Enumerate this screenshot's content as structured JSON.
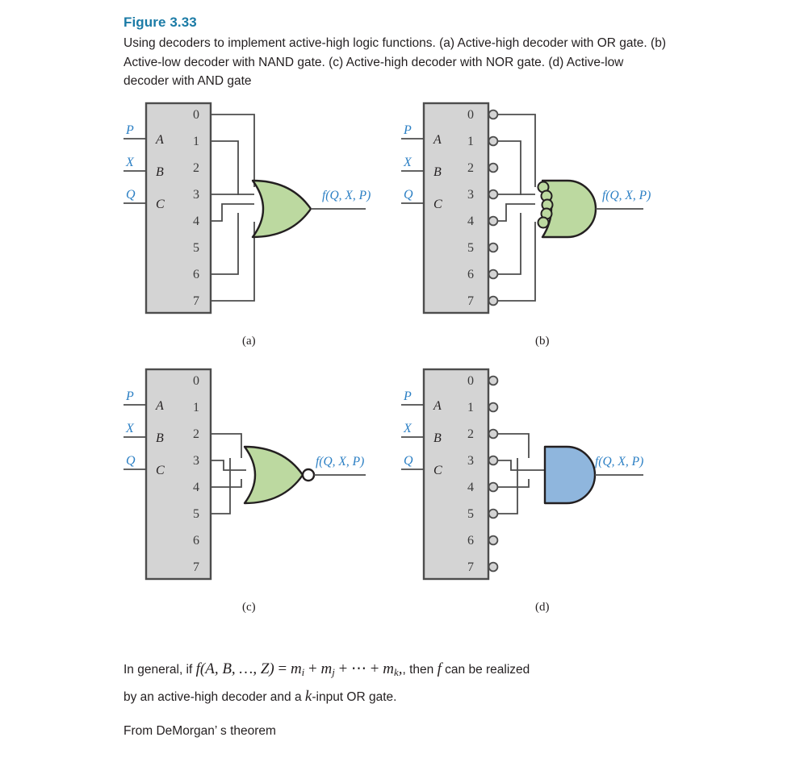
{
  "figure": {
    "title": "Figure 3.33",
    "caption": "Using decoders to implement active-high logic functions. (a) Active-high decoder with OR gate. (b) Active-low decoder with NAND gate. (c) Active-high decoder with NOR gate. (d) Active-low decoder with AND gate"
  },
  "colors": {
    "title_blue": "#1b7ba6",
    "label_blue": "#2b7fc4",
    "decoder_fill": "#d4d4d4",
    "decoder_stroke": "#4d4d4d",
    "or_gate_fill": "#bcd9a0",
    "and_gate_fill": "#8fb6dd",
    "gate_stroke": "#231f20",
    "wire": "#4d4d4d"
  },
  "decoder": {
    "input_labels": [
      "P",
      "X",
      "Q"
    ],
    "input_pins": [
      "A",
      "B",
      "C"
    ],
    "output_pins": [
      "0",
      "1",
      "2",
      "3",
      "4",
      "5",
      "6",
      "7"
    ]
  },
  "panels": [
    {
      "id": "a",
      "label": "(a)",
      "decoder_type": "active-high",
      "active_low_outputs": false,
      "gate": {
        "type": "OR",
        "shape": "or",
        "fill": "#bcd9a0",
        "output_bubble": false,
        "input_bubbles": false,
        "inputs": 5,
        "output_label": "f(Q, X, P)"
      },
      "connected_outputs": [
        "0",
        "1",
        "3",
        "4",
        "6",
        "7"
      ]
    },
    {
      "id": "b",
      "label": "(b)",
      "decoder_type": "active-low",
      "active_low_outputs": true,
      "gate": {
        "type": "NAND",
        "shape": "and",
        "fill": "#bcd9a0",
        "output_bubble": false,
        "input_bubbles": true,
        "inputs": 5,
        "output_label": "f(Q, X, P)"
      },
      "connected_outputs": [
        "0",
        "1",
        "3",
        "4",
        "6",
        "7"
      ]
    },
    {
      "id": "c",
      "label": "(c)",
      "decoder_type": "active-high",
      "active_low_outputs": false,
      "gate": {
        "type": "NOR",
        "shape": "or",
        "fill": "#bcd9a0",
        "output_bubble": true,
        "input_bubbles": false,
        "inputs": 4,
        "output_label": "f(Q, X, P)"
      },
      "connected_outputs": [
        "2",
        "3",
        "4",
        "5"
      ]
    },
    {
      "id": "d",
      "label": "(d)",
      "decoder_type": "active-low",
      "active_low_outputs": true,
      "gate": {
        "type": "AND",
        "shape": "and",
        "fill": "#8fb6dd",
        "output_bubble": false,
        "input_bubbles": false,
        "inputs": 4,
        "output_label": "f(Q, X, P)"
      },
      "connected_outputs": [
        "2",
        "3",
        "4",
        "5"
      ]
    }
  ],
  "body_text": {
    "paragraph1_pre": "In general, if ",
    "paragraph1_math_f": "f(A, B, …, Z) = m",
    "paragraph1_mid": ", then ",
    "paragraph1_post": " can be realized",
    "paragraph1_line2_pre": "by an active-high decoder and a ",
    "paragraph1_line2_post": "-input OR gate.",
    "paragraph2": "From DeMorgan’ s theorem"
  }
}
